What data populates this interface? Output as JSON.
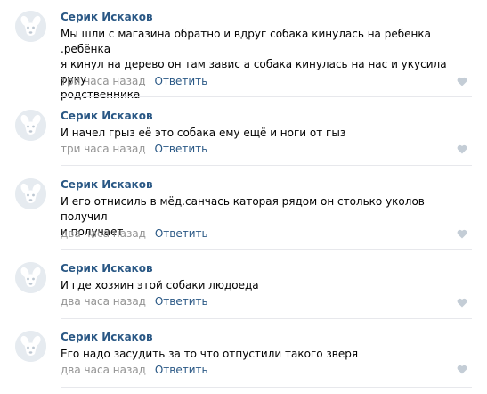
{
  "comments": [
    {
      "author": "Серик Искаков",
      "lines": [
        "Мы шли с магазина обратно и вдруг собака кинулась на ребенка .ребёнка",
        "я кинул на дерево он там завис а собака кинулась на нас и укусила руку",
        "родственника"
      ],
      "time": "три часа назад",
      "reply": "Ответить"
    },
    {
      "author": "Серик Искаков",
      "lines": [
        "И начел грыз её это собака ему ещё и ноги от гыз"
      ],
      "time": "три часа назад",
      "reply": "Ответить"
    },
    {
      "author": "Серик Искаков",
      "lines": [
        "И его отнисиль в мёд.санчась каторая рядом он столько уколов получил",
        "и получает"
      ],
      "time": "два часа назад",
      "reply": "Ответить"
    },
    {
      "author": "Серик Искаков",
      "lines": [
        "И где хозяин этой собаки людоеда"
      ],
      "time": "два часа назад",
      "reply": "Ответить"
    },
    {
      "author": "Серик Искаков",
      "lines": [
        "Его надо засудить за то что отпустили такого зверя"
      ],
      "time": "два часа назад",
      "reply": "Ответить"
    }
  ],
  "colors": {
    "link": "#2a5885",
    "meta": "#939393",
    "divider": "#e7e8ec",
    "avatar_bg": "#e6ebf0"
  },
  "icons": {
    "avatar": "dog-avatar-icon",
    "like": "heart-icon"
  }
}
